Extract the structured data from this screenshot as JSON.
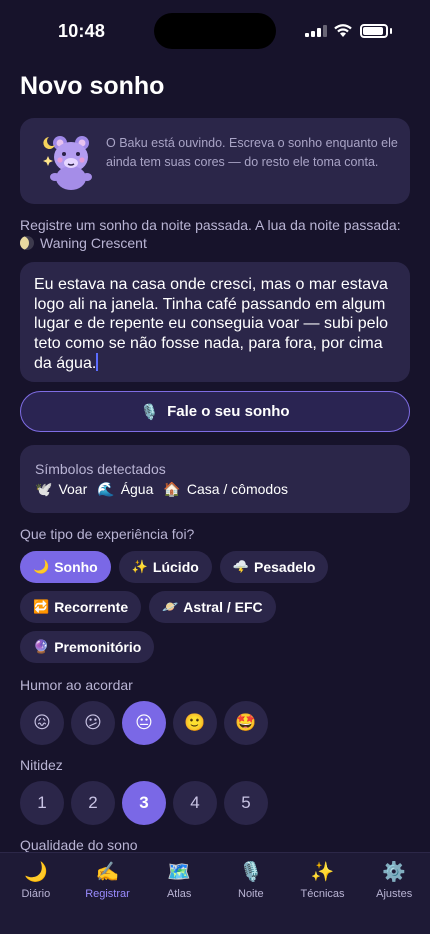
{
  "status": {
    "time": "10:48"
  },
  "page": {
    "title": "Novo sonho"
  },
  "baku": {
    "message": "O Baku está ouvindo. Escreva o sonho enquanto ele ainda tem suas cores — do resto ele toma conta."
  },
  "intro": {
    "text": "Registre um sonho da noite passada.  A lua da noite passada:",
    "moon_phase": "Waning Crescent"
  },
  "dream": {
    "text": "Eu estava na casa onde cresci, mas o mar estava logo ali na janela. Tinha café passando em algum lugar e de repente eu conseguia voar — subi pelo teto como se não fosse nada, para fora, por cima da água."
  },
  "voice": {
    "icon": "🎙️",
    "label": "Fale o seu sonho"
  },
  "symbols": {
    "title": "Símbolos detectados",
    "items": [
      {
        "icon": "🕊️",
        "label": "Voar"
      },
      {
        "icon": "🌊",
        "label": "Água"
      },
      {
        "icon": "🏠",
        "label": "Casa / cômodos"
      }
    ]
  },
  "experience": {
    "label": "Que tipo de experiência foi?",
    "options": [
      {
        "icon": "🌙",
        "label": "Sonho",
        "selected": true
      },
      {
        "icon": "✨",
        "label": "Lúcido",
        "selected": false
      },
      {
        "icon": "🌩️",
        "label": "Pesadelo",
        "selected": false
      },
      {
        "icon": "🔁",
        "label": "Recorrente",
        "selected": false
      },
      {
        "icon": "🪐",
        "label": "Astral / EFC",
        "selected": false
      },
      {
        "icon": "🔮",
        "label": "Premonitório",
        "selected": false
      }
    ]
  },
  "mood": {
    "label": "Humor ao acordar",
    "options": [
      "😖",
      "😕",
      "😐",
      "🙂",
      "🤩"
    ],
    "selected_index": 2
  },
  "clarity": {
    "label": "Nitidez",
    "options": [
      "1",
      "2",
      "3",
      "4",
      "5"
    ],
    "selected_index": 2
  },
  "sleep_quality": {
    "label": "Qualidade do sono"
  },
  "tabs": [
    {
      "icon": "🌙",
      "label": "Diário"
    },
    {
      "icon": "✍️",
      "label": "Registrar"
    },
    {
      "icon": "🗺️",
      "label": "Atlas"
    },
    {
      "icon": "🎙️",
      "label": "Noite"
    },
    {
      "icon": "✨",
      "label": "Técnicas"
    },
    {
      "icon": "⚙️",
      "label": "Ajustes"
    }
  ],
  "active_tab_index": 1,
  "colors": {
    "background": "#17132b",
    "card": "#2b2649",
    "accent": "#7a68e6",
    "accent_text": "#9a8cff"
  }
}
